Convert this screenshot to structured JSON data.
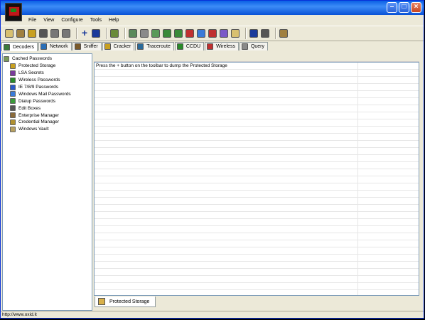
{
  "menu": [
    "File",
    "View",
    "Configure",
    "Tools",
    "Help"
  ],
  "tabs": [
    {
      "label": "Decoders",
      "icon": "decoders-icon",
      "color": "#3b7a3b"
    },
    {
      "label": "Network",
      "icon": "network-icon",
      "color": "#2a6fb8"
    },
    {
      "label": "Sniffer",
      "icon": "sniffer-icon",
      "color": "#7a5a2a"
    },
    {
      "label": "Cracker",
      "icon": "cracker-icon",
      "color": "#c8a020"
    },
    {
      "label": "Traceroute",
      "icon": "traceroute-icon",
      "color": "#2a6a9a"
    },
    {
      "label": "CCDU",
      "icon": "ccdu-icon",
      "color": "#2a8a2a"
    },
    {
      "label": "Wireless",
      "icon": "wireless-icon",
      "color": "#c03030"
    },
    {
      "label": "Query",
      "icon": "query-icon",
      "color": "#8a8a8a"
    }
  ],
  "tree": {
    "root": "Cached Passwords",
    "children": [
      {
        "label": "Protected Storage",
        "icon": "protected-storage-icon",
        "color": "#c8a020"
      },
      {
        "label": "LSA Secrets",
        "icon": "lsa-secrets-icon",
        "color": "#7a3a9a"
      },
      {
        "label": "Wireless Passwords",
        "icon": "wireless-passwords-icon",
        "color": "#2a8a2a"
      },
      {
        "label": "IE 7/8/9 Passwords",
        "icon": "ie-icon",
        "color": "#2a5ac8"
      },
      {
        "label": "Windows Mail Passwords",
        "icon": "windows-mail-icon",
        "color": "#3a7ad8"
      },
      {
        "label": "Dialup Passwords",
        "icon": "dialup-icon",
        "color": "#3a9a3a"
      },
      {
        "label": "Edit Boxes",
        "icon": "edit-boxes-icon",
        "color": "#555555"
      },
      {
        "label": "Enterprise Manager",
        "icon": "enterprise-manager-icon",
        "color": "#8a6a3a"
      },
      {
        "label": "Credential Manager",
        "icon": "credential-manager-icon",
        "color": "#b09030"
      },
      {
        "label": "Windows Vault",
        "icon": "windows-vault-icon",
        "color": "#b8a060"
      }
    ]
  },
  "main": {
    "message": "Press the + button on the toolbar to dump the Protected Storage"
  },
  "bottom_tab": "Protected Storage",
  "status": "http://www.oxid.it",
  "toolbar_icon_colors": [
    "#d8c070",
    "#a08040",
    "#c8a020",
    "#555",
    "#777",
    "#777",
    "#1a3a9a",
    "#6a8a3a",
    "#5a8a5a",
    "#8a8a8a",
    "#5a9a5a",
    "#3a8a3a",
    "#3a8a3a",
    "#c03030",
    "#3a7ad8",
    "#c03030",
    "#7a5ac8",
    "#d8c070",
    "#1a3a9a",
    "#555",
    "#a08040"
  ]
}
